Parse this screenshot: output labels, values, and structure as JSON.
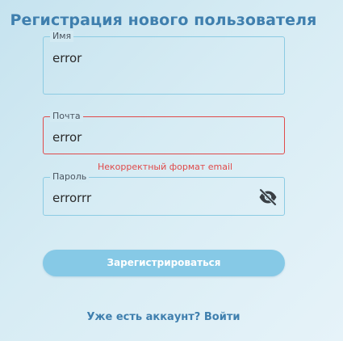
{
  "title": "Регистрация нового пользователя",
  "form": {
    "name": {
      "label": "Имя",
      "value": "error"
    },
    "email": {
      "label": "Почта",
      "value": "error",
      "error": "Некорректный формат email"
    },
    "password": {
      "label": "Пароль",
      "value": "errorrr",
      "toggle_icon": "eye-off-icon"
    },
    "submit_label": "Зарегистрироваться"
  },
  "footer": {
    "login_link": "Уже есть аккаунт? Войти"
  },
  "colors": {
    "accent": "#3f7fae",
    "field_border": "#8ccbe3",
    "error": "#e04a4a",
    "button": "#86c9e6"
  }
}
